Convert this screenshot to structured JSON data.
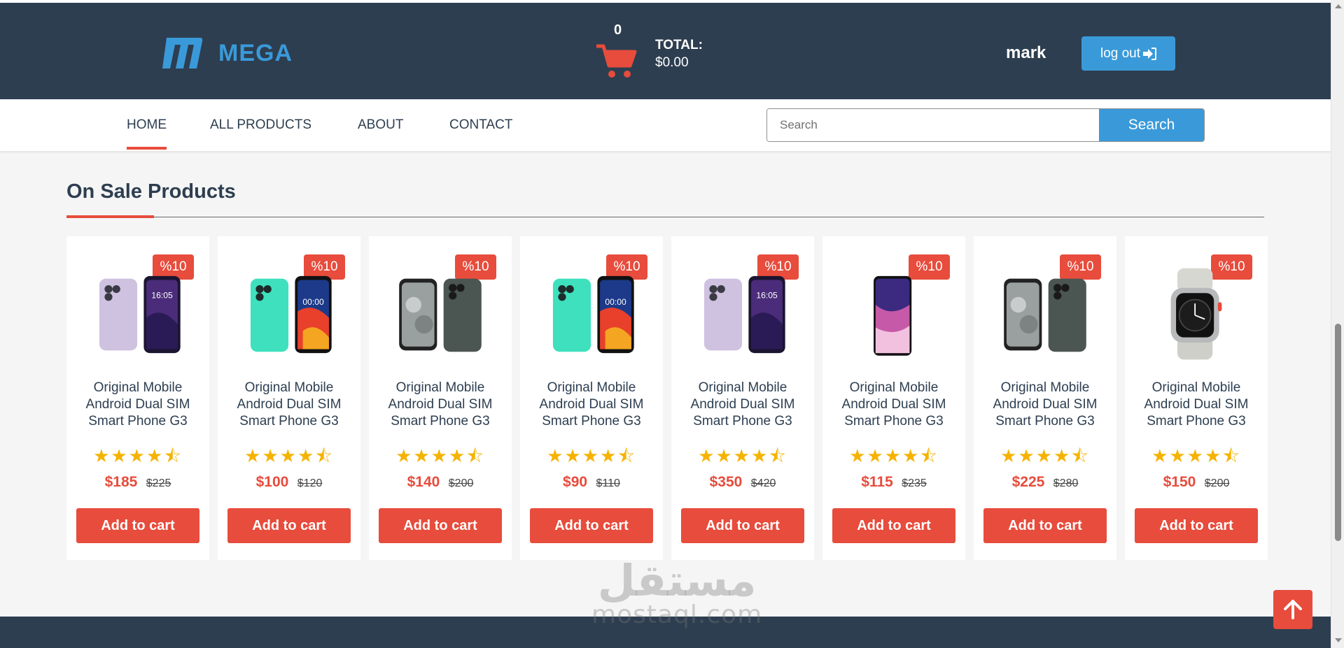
{
  "header": {
    "brand": "MEGA",
    "cart_count": "0",
    "total_label": "TOTAL:",
    "total_amount": "$0.00",
    "username": "mark",
    "logout_label": "log out"
  },
  "nav": {
    "items": [
      {
        "label": "HOME",
        "active": true
      },
      {
        "label": "ALL PRODUCTS",
        "active": false
      },
      {
        "label": "ABOUT",
        "active": false
      },
      {
        "label": "CONTACT",
        "active": false
      }
    ],
    "search_placeholder": "Search",
    "search_button": "Search"
  },
  "section": {
    "title": "On Sale Products"
  },
  "products": [
    {
      "badge": "%10",
      "name": "Original Mobile Android Dual SIM Smart Phone G3",
      "stars": "★★★★⯪",
      "rating": 4.5,
      "price": "$185",
      "old_price": "$225",
      "button": "Add to cart",
      "image": "purple-phone"
    },
    {
      "badge": "%10",
      "name": "Original Mobile Android Dual SIM Smart Phone G3",
      "stars": "★★★★⯪",
      "rating": 4.5,
      "price": "$100",
      "old_price": "$120",
      "button": "Add to cart",
      "image": "mint-phone"
    },
    {
      "badge": "%10",
      "name": "Original Mobile Android Dual SIM Smart Phone G3",
      "stars": "★★★★⯪",
      "rating": 4.5,
      "price": "$140",
      "old_price": "$200",
      "button": "Add to cart",
      "image": "gray-phone"
    },
    {
      "badge": "%10",
      "name": "Original Mobile Android Dual SIM Smart Phone G3",
      "stars": "★★★★⯪",
      "rating": 4.5,
      "price": "$90",
      "old_price": "$110",
      "button": "Add to cart",
      "image": "mint-phone"
    },
    {
      "badge": "%10",
      "name": "Original Mobile Android Dual SIM Smart Phone G3",
      "stars": "★★★★⯪",
      "rating": 4.5,
      "price": "$350",
      "old_price": "$420",
      "button": "Add to cart",
      "image": "purple-phone"
    },
    {
      "badge": "%10",
      "name": "Original Mobile Android Dual SIM Smart Phone G3",
      "stars": "★★★★⯪",
      "rating": 4.5,
      "price": "$115",
      "old_price": "$235",
      "button": "Add to cart",
      "image": "galaxy-phone"
    },
    {
      "badge": "%10",
      "name": "Original Mobile Android Dual SIM Smart Phone G3",
      "stars": "★★★★⯪",
      "rating": 4.5,
      "price": "$225",
      "old_price": "$280",
      "button": "Add to cart",
      "image": "gray-phone"
    },
    {
      "badge": "%10",
      "name": "Original Mobile Android Dual SIM Smart Phone G3",
      "stars": "★★★★⯪",
      "rating": 4.5,
      "price": "$150",
      "old_price": "$200",
      "button": "Add to cart",
      "image": "smart-watch"
    }
  ],
  "watermark": {
    "arabic": "مستقل",
    "latin": "mostaql.com"
  },
  "colors": {
    "header_bg": "#2d3e50",
    "accent_blue": "#3a9ad9",
    "accent_red": "#e74c3c",
    "star": "#f5b301"
  }
}
